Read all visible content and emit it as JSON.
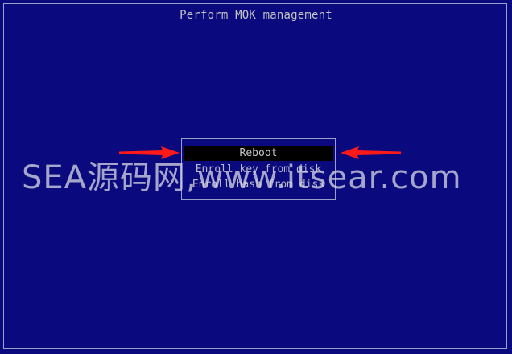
{
  "screen": {
    "title": "Perform MOK management",
    "menu": {
      "items": [
        {
          "label": "Reboot",
          "selected": true
        },
        {
          "label": "Enroll key from disk",
          "selected": false
        },
        {
          "label": "Enroll hash from disk",
          "selected": false
        }
      ]
    },
    "overlay": {
      "watermark": "SEA源码网,www.itsear.com",
      "annotation_color": "#ff1a1a"
    },
    "colors": {
      "background": "#0a0a7e",
      "border": "#9aa0c8",
      "text": "#c3c3c3",
      "selection_bg": "#000000"
    }
  }
}
